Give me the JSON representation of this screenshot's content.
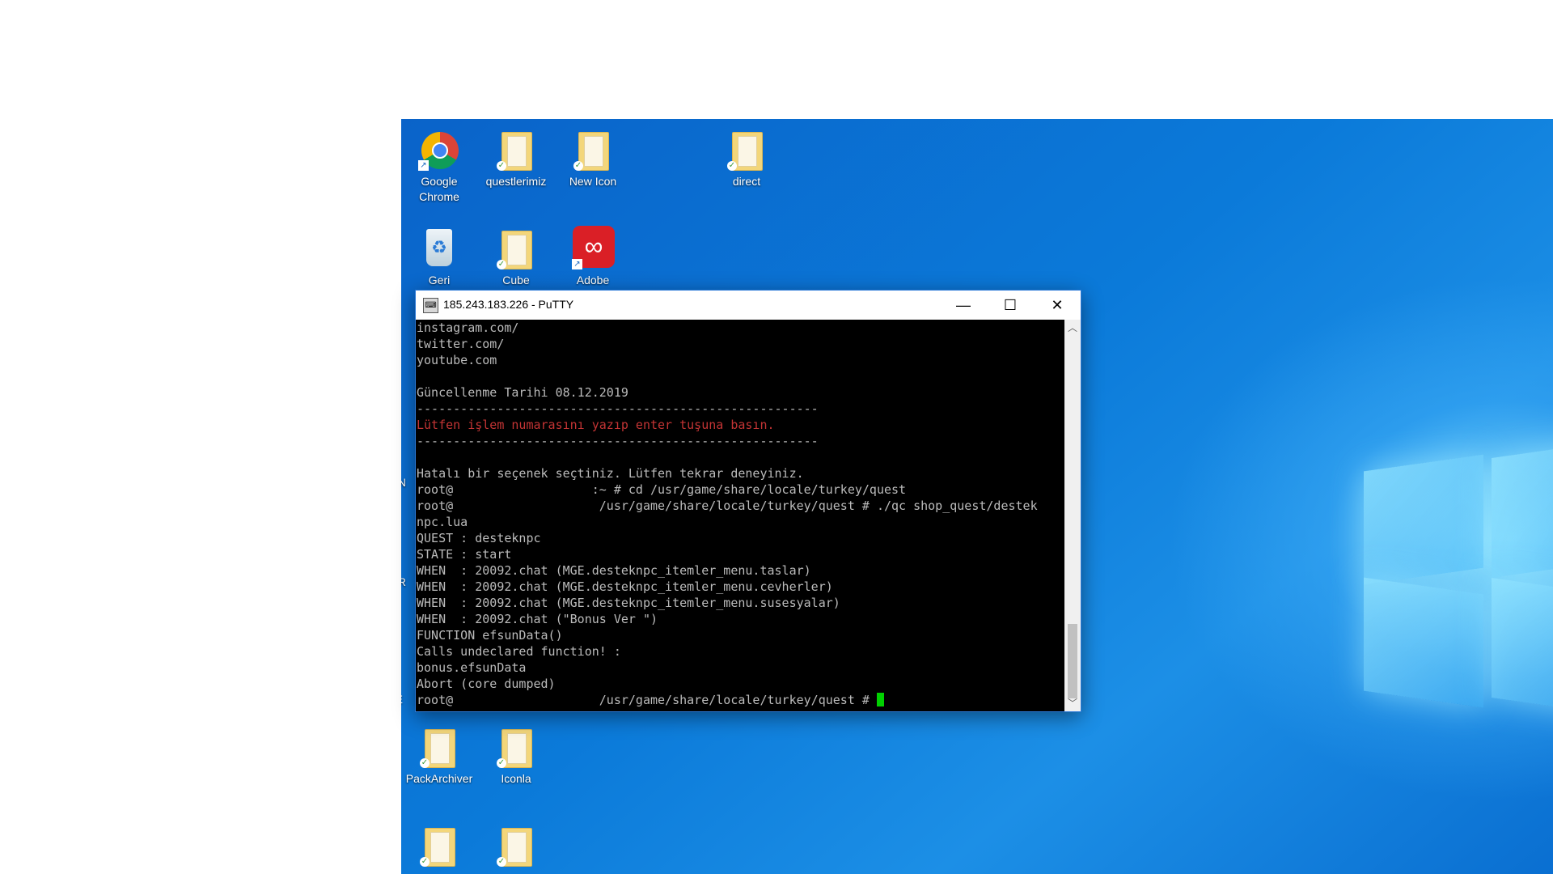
{
  "desktop": {
    "icons": [
      {
        "label": "Google\nChrome",
        "kind": "chrome"
      },
      {
        "label": "questlerimiz",
        "kind": "folder"
      },
      {
        "label": "New Icon",
        "kind": "folder"
      },
      {
        "label": "direct",
        "kind": "folder"
      },
      {
        "label": "Geri",
        "kind": "recycle"
      },
      {
        "label": "Cube",
        "kind": "folder"
      },
      {
        "label": "Adobe",
        "kind": "adobe"
      },
      {
        "label": "PackArchiver",
        "kind": "folder"
      },
      {
        "label": "Iconla",
        "kind": "folder"
      }
    ],
    "partial_letters": [
      "N",
      "R",
      "E"
    ]
  },
  "putty": {
    "title": "185.243.183.226 - PuTTY",
    "minimize": "—",
    "maximize": "☐",
    "close": "✕",
    "terminal_lines": [
      {
        "text": "instagram.com/"
      },
      {
        "text": "twitter.com/"
      },
      {
        "text": "youtube.com"
      },
      {
        "text": ""
      },
      {
        "text": "Güncellenme Tarihi 08.12.2019"
      },
      {
        "text": "-------------------------------------------------------"
      },
      {
        "text": "Lütfen işlem numarasını yazıp enter tuşuna basın.",
        "color": "red"
      },
      {
        "text": "-------------------------------------------------------"
      },
      {
        "text": ""
      },
      {
        "text": "Hatalı bir seçenek seçtiniz. Lütfen tekrar deneyiniz."
      },
      {
        "text": "root@                   :~ # cd /usr/game/share/locale/turkey/quest"
      },
      {
        "text": "root@                    /usr/game/share/locale/turkey/quest # ./qc shop_quest/destek"
      },
      {
        "text": "npc.lua"
      },
      {
        "text": "QUEST : desteknpc"
      },
      {
        "text": "STATE : start"
      },
      {
        "text": "WHEN  : 20092.chat (MGE.desteknpc_itemler_menu.taslar)"
      },
      {
        "text": "WHEN  : 20092.chat (MGE.desteknpc_itemler_menu.cevherler)"
      },
      {
        "text": "WHEN  : 20092.chat (MGE.desteknpc_itemler_menu.susesyalar)"
      },
      {
        "text": "WHEN  : 20092.chat (\"Bonus Ver \")"
      },
      {
        "text": "FUNCTION efsunData()"
      },
      {
        "text": "Calls undeclared function! :"
      },
      {
        "text": "bonus.efsunData"
      },
      {
        "text": "Abort (core dumped)"
      },
      {
        "text": "root@                    /usr/game/share/locale/turkey/quest # ",
        "cursor": true
      }
    ],
    "cursor_color": "#00d000"
  }
}
